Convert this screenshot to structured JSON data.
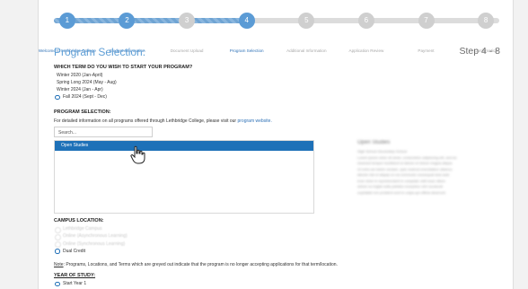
{
  "progress": {
    "steps": [
      {
        "number": "1",
        "label": "Welcome to Lethbridge College",
        "state": "done"
      },
      {
        "number": "2",
        "label": "Student Information",
        "state": "done"
      },
      {
        "number": "3",
        "label": "Document Upload",
        "state": "todo"
      },
      {
        "number": "4",
        "label": "Program Selection",
        "state": "done"
      },
      {
        "number": "5",
        "label": "Additional Information",
        "state": "todo"
      },
      {
        "number": "6",
        "label": "Application Review",
        "state": "todo"
      },
      {
        "number": "7",
        "label": "Payment",
        "state": "todo"
      },
      {
        "number": "8",
        "label": "Confirmation",
        "state": "todo"
      }
    ],
    "completed_fraction": 0.43
  },
  "header": {
    "title": "Program Selection:",
    "step_counter": "Step 4 - 8"
  },
  "term": {
    "question": "WHICH TERM DO YOU WISH TO START YOUR PROGRAM?",
    "options": [
      {
        "label": "Winter 2020 (Jan-April)",
        "state": "plain"
      },
      {
        "label": "Spring Long 2024 (May - Aug)",
        "state": "plain"
      },
      {
        "label": "Winter 2024 (Jan - Apr)",
        "state": "plain"
      },
      {
        "label": "Fall 2024 (Sept - Dec)",
        "state": "selected"
      }
    ]
  },
  "program": {
    "heading": "PROGRAM SELECTION:",
    "info_text": "For detailed information on all programs offered through Lethbridge College, please visit our",
    "info_link": "program website.",
    "search_placeholder": "Search...",
    "list_items": [
      "Open Studies"
    ]
  },
  "details_panel": {
    "title": "Open Studies",
    "lines": [
      "High School Secondary School",
      "Lorem ipsum dolor sit amet, consectetur adipiscing elit, sed do",
      "eiusmod tempor incididunt ut labore et dolore magna aliqua.",
      "Ut enim ad minim veniam, quis nostrud exercitation ullamco",
      "laboris nisi ut aliquip ex ea commodo consequat duis aute",
      "irure dolor in reprehenderit in voluptate velit esse cillum",
      "dolore eu fugiat nulla pariatur excepteur sint occaecat",
      "cupidatat non proident sunt in culpa qui officia deserunt."
    ]
  },
  "campus": {
    "heading": "CAMPUS LOCATION:",
    "options": [
      {
        "label": "Lethbridge Campus",
        "state": "disabled"
      },
      {
        "label": "Online (Asynchronous Learning)",
        "state": "disabled"
      },
      {
        "label": "Online (Synchronous Learning)",
        "state": "disabled"
      },
      {
        "label": "Dual Credit",
        "state": "selected"
      }
    ]
  },
  "note": {
    "label": "Note",
    "text": ": Programs, Locations, and Terms which are greyed out indicate that the program is no longer accepting applications for that term/location."
  },
  "year": {
    "heading": "YEAR OF STUDY:",
    "options": [
      {
        "label": "Start Year 1",
        "state": "selected"
      }
    ]
  },
  "colors": {
    "accent": "#5b9bd5",
    "selected_row": "#1e71b8",
    "link": "#2f72b7"
  }
}
